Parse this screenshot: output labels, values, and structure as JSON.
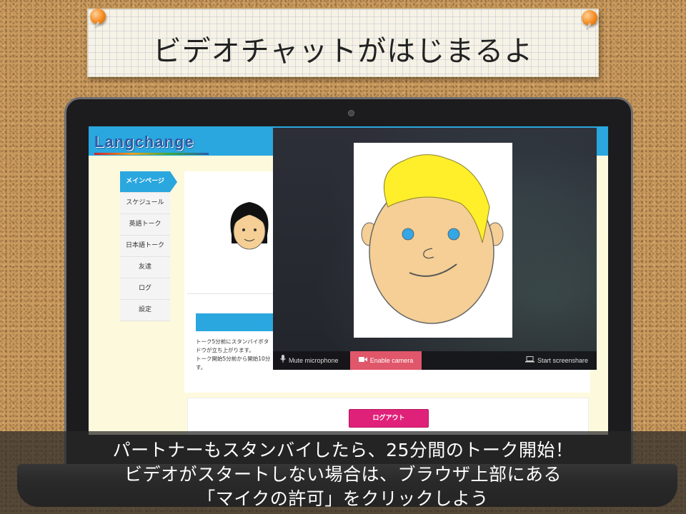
{
  "title": "ビデオチャットがはじまるよ",
  "site": {
    "logo": "Langchange",
    "sidebar_items": [
      "メインページ",
      "スケジュール",
      "英語トーク",
      "日本語トーク",
      "友達",
      "ログ",
      "設定"
    ],
    "standby_text": "トーク5分前にスタンバイボタ\nドウが立ち上がります。\nトーク開始5分前から開始10分\nす。",
    "logout_label": "ログアウト"
  },
  "video": {
    "mute_label": "Mute microphone",
    "camera_label": "Enable camera",
    "screenshare_label": "Start screenshare"
  },
  "caption": {
    "line1": "パートナーもスタンバイしたら、25分間のトーク開始！",
    "line2": "ビデオがスタートしない場合は、ブラウザ上部にある",
    "line3": "「マイクの許可」をクリックしよう"
  },
  "colors": {
    "site_blue": "#2aa7df",
    "logout_pink": "#e0217a",
    "camera_red": "#e0566a",
    "cork": "#c99a5e"
  },
  "icons": [
    "pushpin-icon",
    "microphone-icon",
    "video-camera-icon",
    "laptop-icon"
  ]
}
